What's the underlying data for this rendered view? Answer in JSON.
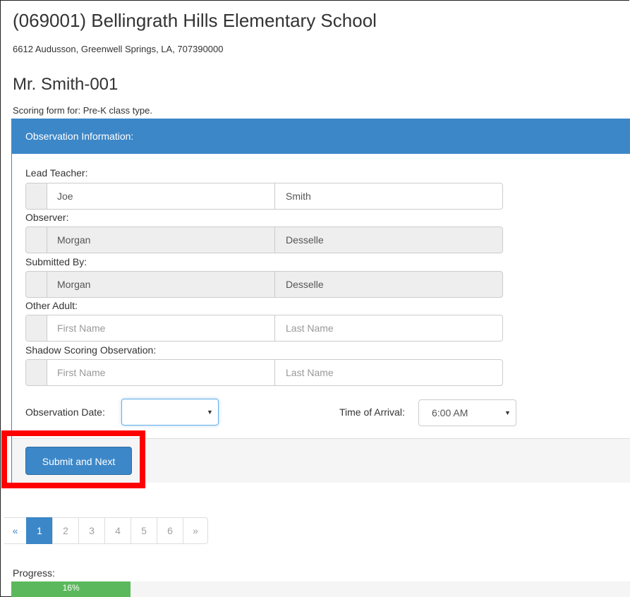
{
  "school": {
    "title": "(069001) Bellingrath Hills Elementary School",
    "address": "6612 Audusson, Greenwell Springs, LA, 707390000"
  },
  "teacher_heading": "Mr. Smith-001",
  "scoring_note": "Scoring form for: Pre-K class type.",
  "panel": {
    "heading": "Observation Information:",
    "lead_teacher": {
      "label": "Lead Teacher:",
      "first": "Joe",
      "last": "Smith",
      "readonly": false
    },
    "observer": {
      "label": "Observer:",
      "first": "Morgan",
      "last": "Desselle",
      "readonly": true
    },
    "submitted_by": {
      "label": "Submitted By:",
      "first": "Morgan",
      "last": "Desselle",
      "readonly": true
    },
    "other_adult": {
      "label": "Other Adult:",
      "first_placeholder": "First Name",
      "last_placeholder": "Last Name"
    },
    "shadow_scoring": {
      "label": "Shadow Scoring Observation:",
      "first_placeholder": "First Name",
      "last_placeholder": "Last Name"
    },
    "observation_date": {
      "label": "Observation Date:",
      "value": ""
    },
    "time_of_arrival": {
      "label": "Time of Arrival:",
      "value": "6:00 AM"
    },
    "submit_label": "Submit and Next"
  },
  "pagination": {
    "prev": "«",
    "pages": [
      "1",
      "2",
      "3",
      "4",
      "5",
      "6"
    ],
    "active": "1",
    "next": "»"
  },
  "progress": {
    "label": "Progress:",
    "percent": 16,
    "text": "16%"
  },
  "colors": {
    "primary": "#3c87c8",
    "success": "#5cb85c",
    "highlight": "#ff0000"
  }
}
